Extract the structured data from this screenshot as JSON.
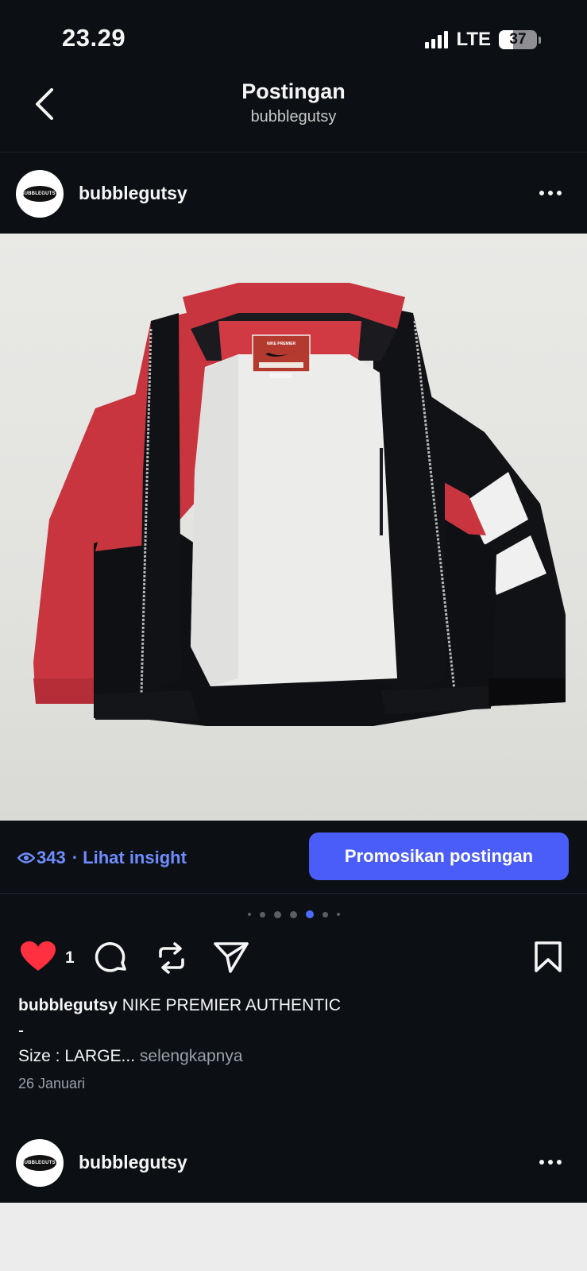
{
  "status_bar": {
    "time": "23.29",
    "network": "LTE",
    "battery": "37"
  },
  "header": {
    "title": "Postingan",
    "subtitle": "bubblegutsy"
  },
  "post": {
    "username": "bubblegutsy",
    "avatar_text": "BUBBLEGUTSY",
    "views": "343",
    "insight_label": "· Lihat insight",
    "promote_label": "Promosikan postingan",
    "carousel": {
      "total": 7,
      "active_index": 4
    },
    "like_count": "1",
    "caption_username": "bubblegutsy",
    "caption_line1": "NIKE PREMIER AUTHENTIC",
    "caption_line2": "-",
    "caption_line3": "Size : LARGE...",
    "more_label": "selengkapnya",
    "date": "26 Januari",
    "photo_label": {
      "brand": "NIKE PREMIER"
    }
  },
  "next_post": {
    "username": "bubblegutsy",
    "avatar_text": "BUBBLEGUTSY"
  },
  "colors": {
    "background": "#0c1014",
    "accent_link": "#6f8cff",
    "promote_button": "#4a5df9",
    "heart": "#ff3040"
  }
}
